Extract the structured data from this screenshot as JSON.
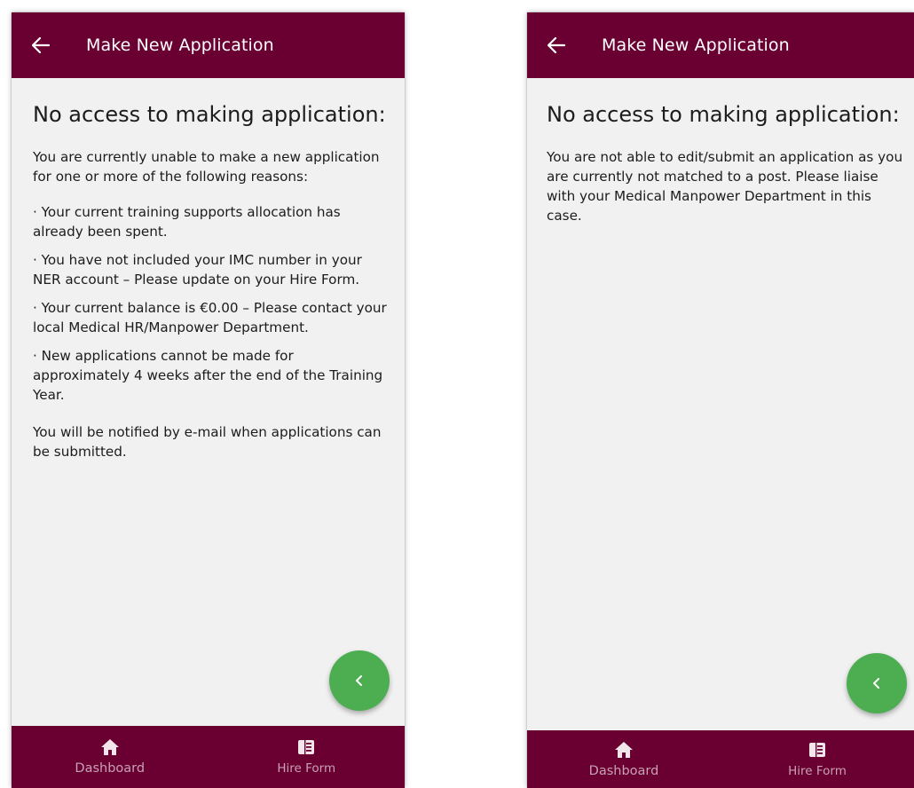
{
  "screens": [
    {
      "appbar": {
        "title": "Make New Application",
        "back_icon": "arrow-left-icon"
      },
      "heading": "No access to making application:",
      "intro": "You are currently unable to make a new application for one or more of the following reasons:",
      "reasons": [
        "· Your current training supports allocation has already been spent.",
        "· You have not included your IMC number in your NER account – Please update on your Hire Form.",
        "· Your current balance is €0.00 – Please contact your local Medical HR/Manpower Department.",
        "· New applications cannot be made for approximately 4 weeks after the end of the Training Year."
      ],
      "footer_note": "You will be notified by e-mail when applications can be submitted.",
      "fab_icon": "chevron-left-icon",
      "nav": [
        {
          "label": "Dashboard",
          "icon": "home-icon"
        },
        {
          "label": "Hire Form",
          "icon": "form-icon"
        }
      ]
    },
    {
      "appbar": {
        "title": "Make New Application",
        "back_icon": "arrow-left-icon"
      },
      "heading": "No access to making application:",
      "message": "You are not able to edit/submit an application as you are currently not matched to a post. Please liaise with your Medical Manpower Department in this case.",
      "fab_icon": "chevron-left-icon",
      "nav": [
        {
          "label": "Dashboard",
          "icon": "home-icon"
        },
        {
          "label": "Hire Form",
          "icon": "form-icon"
        }
      ]
    }
  ],
  "colors": {
    "appbar": "#6a0032",
    "background": "#f1f1f1",
    "fab": "#4cae50",
    "nav_text": "#c8a2b3"
  }
}
